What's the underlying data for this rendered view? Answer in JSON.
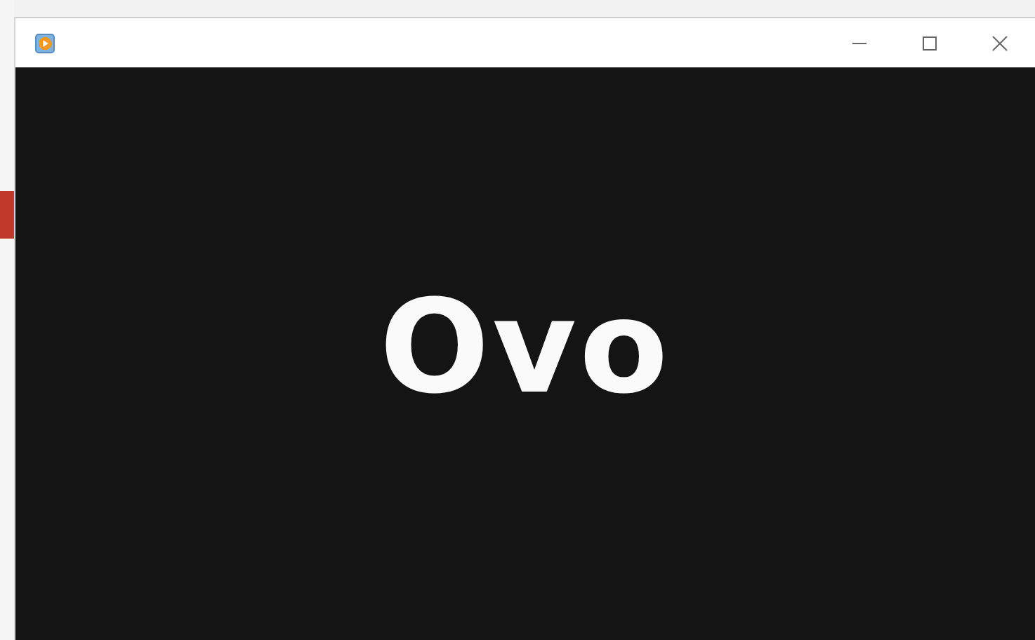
{
  "window": {
    "content_text": "Ovo"
  }
}
